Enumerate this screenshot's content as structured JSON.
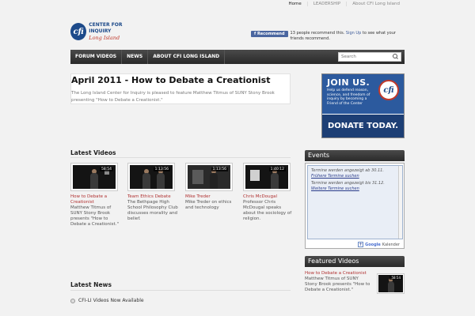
{
  "top_nav": [
    "Home",
    "LEADERSHIP",
    "About CFI Long Island"
  ],
  "logo": {
    "mark": "cfi",
    "line1": "CENTER FOR INQUIRY",
    "line2": "Long Island"
  },
  "recommend": {
    "button": "Recommend",
    "text": "13 people recommend this.",
    "signup": "Sign Up",
    "suffix": "to see what your friends recommend."
  },
  "navbar": {
    "items": [
      "FORUM VIDEOS",
      "NEWS",
      "ABOUT CFI LONG ISLAND"
    ],
    "search_placeholder": "Search"
  },
  "feature": {
    "title": "April 2011 - How to Debate a Creationist",
    "desc": "The Long Island Center for Inquiry is pleased to feature Matthew Titmus of SUNY Stony Brook presenting \"How to Debate a Creationist.\""
  },
  "join": {
    "title": "JOIN US.",
    "small": "Help us defend reason, science, and freedom of inquiry by becoming a Friend of the Center",
    "badge": "cfi",
    "donate": "DONATE TODAY."
  },
  "latest_videos": {
    "heading": "Latest Videos",
    "items": [
      {
        "duration": "58:54",
        "title": "How to Debate a Creationist",
        "desc": "Matthew Titmus of SUNY Stony Brook presents \"How to Debate a Creationist.\""
      },
      {
        "duration": "1:13:56",
        "title": "Team Ethics Debate",
        "desc": "The Bethpage High School Philosophy Club discusses morality and belief."
      },
      {
        "duration": "1:13:56",
        "title": "Mike Treder",
        "desc": "Mike Treder on ethics and technology"
      },
      {
        "duration": "1:40:12",
        "title": "Chris McDougal",
        "desc": "Professor Chris McDougal speaks about the sociology of religion."
      }
    ]
  },
  "latest_news": {
    "heading": "Latest News",
    "items": [
      "CFI-LI Videos Now Available"
    ]
  },
  "events": {
    "heading": "Events",
    "line1": "Termine werden angezeigt ab 30.11.",
    "link1": "Frühere Termine suchen",
    "line2": "Termine werden angezeigt bis 31.12.",
    "link2": "Weitere Termine suchen",
    "footer_google": "Google",
    "footer_kalender": "Kalender"
  },
  "featured_videos": {
    "heading": "Featured Videos",
    "title": "How to Debate a Creationist",
    "desc": "Matthew Titmus of SUNY Stony Brook presents \"How to Debate a Creationist.\"",
    "duration": "58:54"
  }
}
